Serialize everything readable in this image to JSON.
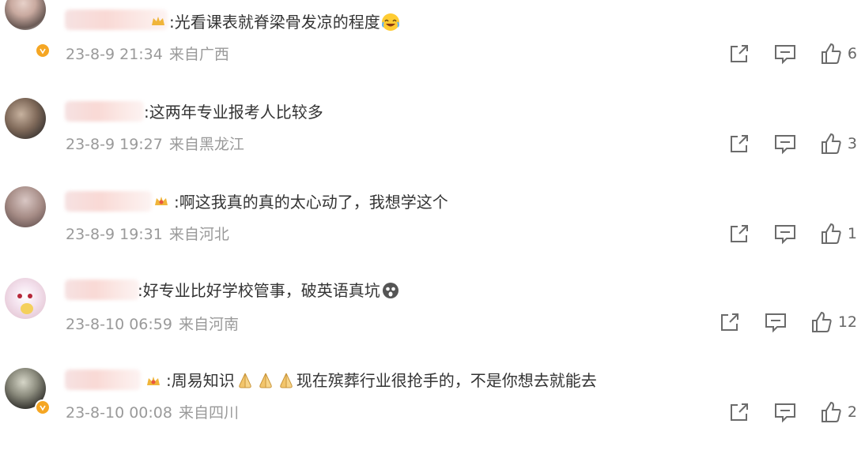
{
  "comments": [
    {
      "text": ":光看课表就脊梁骨发凉的程度",
      "emoji": "laughing-tears-emoji",
      "date": "23-8-9 21:34",
      "location": "来自广西",
      "likes": "6",
      "verified": true,
      "crown": true
    },
    {
      "text": ":这两年专业报考人比较多",
      "date": "23-8-9 19:27",
      "location": "来自黑龙江",
      "likes": "3",
      "verified": false,
      "crown": false
    },
    {
      "text": ":啊这我真的真的太心动了，我想学这个",
      "date": "23-8-9 19:31",
      "location": "来自河北",
      "likes": "1",
      "verified": false,
      "crown": true
    },
    {
      "text": ":好专业比好学校管事，破英语真坑",
      "emoji": "scream-emoji",
      "date": "23-8-10 06:59",
      "location": "来自河南",
      "likes": "12",
      "verified": false,
      "crown": false
    },
    {
      "text_before": ":周易知识",
      "emojis": [
        "pray-hands-emoji",
        "pray-hands-emoji",
        "pray-hands-emoji"
      ],
      "text_after": "现在殡葬行业很抢手的，不是你想去就能去",
      "date": "23-8-10 00:08",
      "location": "来自四川",
      "likes": "2",
      "verified": true,
      "crown": true
    }
  ],
  "icons": {
    "share": "share-icon",
    "reply": "comment-icon",
    "like": "thumb-up-icon"
  },
  "colors": {
    "text": "#333333",
    "meta": "#9a9a9a",
    "icon": "#6b6b6b",
    "verified_badge": "#f5a623"
  }
}
